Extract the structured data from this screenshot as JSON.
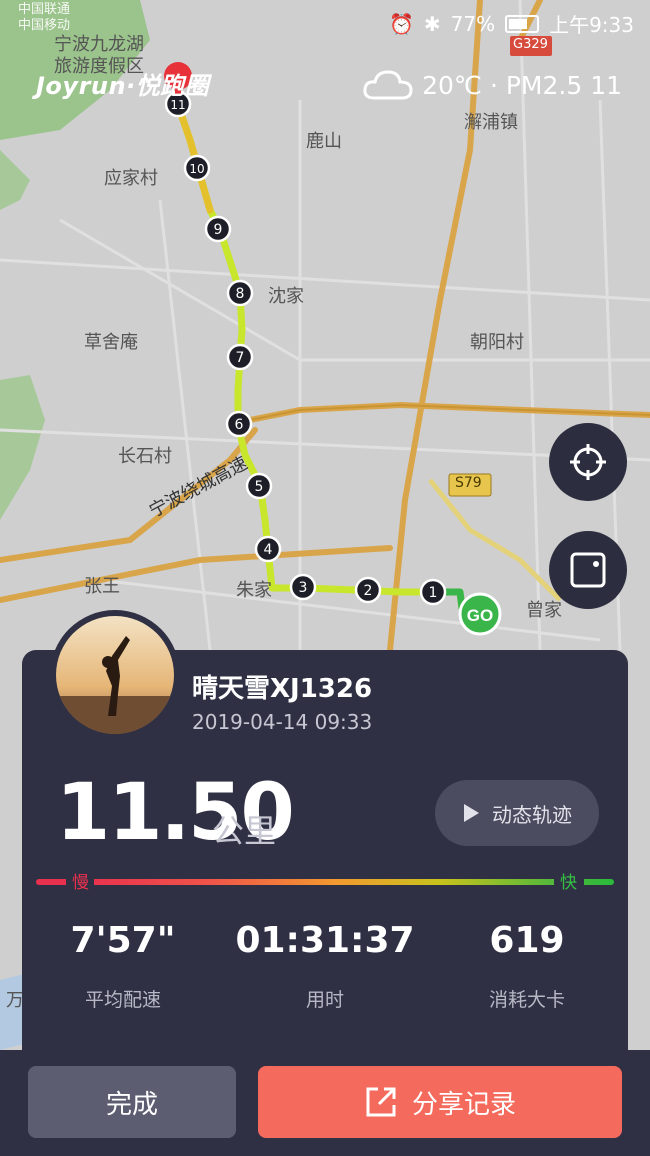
{
  "status_bar": {
    "carrier1": "中国联通",
    "carrier2": "中国移动",
    "battery": "77%",
    "time": "上午9:33"
  },
  "header": {
    "app_name": "Joyrun·悦跑圈",
    "weather": "20℃ · PM2.5 11"
  },
  "map": {
    "labels": {
      "lake": "宁波九龙湖",
      "resort": "旅游度假区",
      "town": "澥浦镇",
      "road_tag": "G329",
      "luoshan": "鹿山",
      "yingjiacun": "应家村",
      "shenjia": "沈家",
      "caoshean": "草舍庵",
      "chaoyangcun": "朝阳村",
      "changshicun": "长石村",
      "highway": "宁波绕城高速",
      "s79": "S79",
      "zhangwang": "张王",
      "zhujia": "朱家",
      "zengjia": "曾家",
      "wan": "万"
    },
    "start_marker": "GO",
    "km_markers": [
      "1",
      "2",
      "3",
      "4",
      "5",
      "6",
      "7",
      "8",
      "9",
      "10",
      "11"
    ]
  },
  "card": {
    "username": "晴天雪XJ1326",
    "datetime": "2019-04-14 09:33",
    "distance": "11.50",
    "distance_unit": "公里",
    "track_button": "动态轨迹",
    "slow": "慢",
    "fast": "快",
    "stats": [
      {
        "value": "7'57\"",
        "label": "平均配速"
      },
      {
        "value": "01:31:37",
        "label": "用时"
      },
      {
        "value": "619",
        "label": "消耗大卡"
      }
    ]
  },
  "actions": {
    "done": "完成",
    "share": "分享记录"
  },
  "colors": {
    "card_bg": "#2f3043",
    "share_btn": "#f46b5d",
    "route": "#c8e62c",
    "start": "#3ab54a"
  }
}
